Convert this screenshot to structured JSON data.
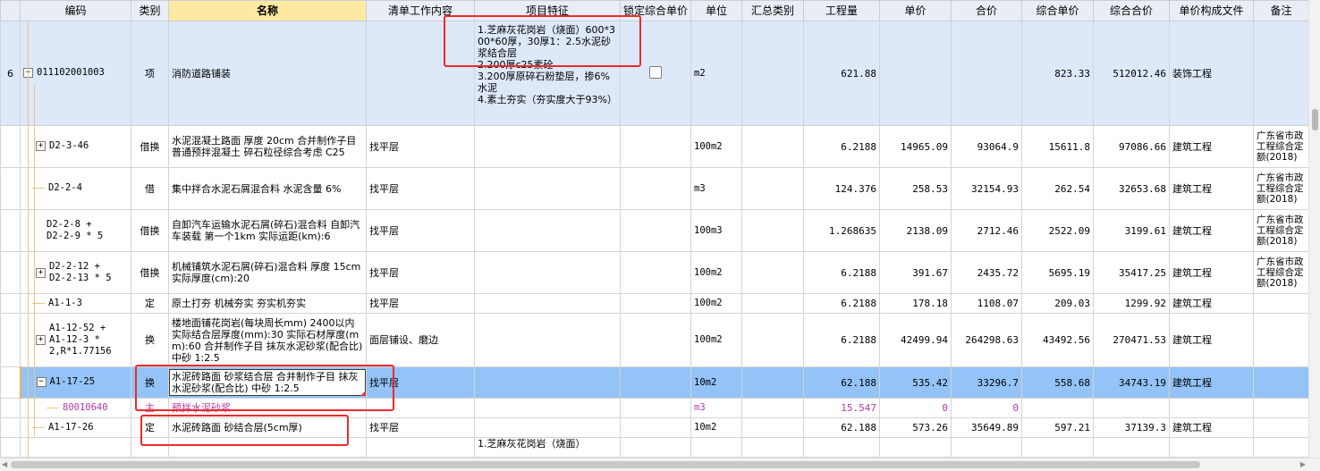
{
  "columns": [
    "编码",
    "类别",
    "名称",
    "清单工作内容",
    "项目特征",
    "锁定综合单价",
    "单位",
    "汇总类别",
    "工程量",
    "单价",
    "合价",
    "综合单价",
    "综合合价",
    "单价构成文件",
    "备注"
  ],
  "rows": [
    {
      "num": "6",
      "code": "011102001003",
      "type": "项",
      "name": "消防道路铺装",
      "work": "",
      "feature": "1.芝麻灰花岗岩（烧面）600*300*60厚，30厚1：2.5水泥砂浆结合层\n2.200厚c25素砼\n3.200厚原碎石粉垫层，掺6%水泥\n4.素土夯实（夯实度大于93%）",
      "unit": "m2",
      "qty": "621.88",
      "price": "",
      "total": "",
      "uprice": "823.33",
      "utotal": "512012.46",
      "file": "装饰工程",
      "remark": ""
    },
    {
      "num": "",
      "code": "D2-3-46",
      "type": "借换",
      "name": "水泥混凝土路面 厚度 20cm  合并制作子目 普通预拌混凝土 碎石粒径综合考虑 C25",
      "work": "找平层",
      "feature": "",
      "unit": "100m2",
      "qty": "6.2188",
      "price": "14965.09",
      "total": "93064.9",
      "uprice": "15611.8",
      "utotal": "97086.66",
      "file": "建筑工程",
      "remark": "广东省市政工程综合定额(2018)"
    },
    {
      "num": "",
      "code": "D2-2-4",
      "type": "借",
      "name": "集中拌合水泥石屑混合料 水泥含量 6%",
      "work": "找平层",
      "feature": "",
      "unit": "m3",
      "qty": "124.376",
      "price": "258.53",
      "total": "32154.93",
      "uprice": "262.54",
      "utotal": "32653.68",
      "file": "建筑工程",
      "remark": "广东省市政工程综合定额(2018)"
    },
    {
      "num": "",
      "code": "D2-2-8 +\nD2-2-9 * 5",
      "type": "借换",
      "name": "自卸汽车运输水泥石屑(碎石)混合料 自卸汽车装载 第一个1km  实际运距(km):6",
      "work": "找平层",
      "feature": "",
      "unit": "100m3",
      "qty": "1.268635",
      "price": "2138.09",
      "total": "2712.46",
      "uprice": "2522.09",
      "utotal": "3199.61",
      "file": "建筑工程",
      "remark": "广东省市政工程综合定额(2018)"
    },
    {
      "num": "",
      "code": "D2-2-12 +\nD2-2-13 * 5",
      "type": "借换",
      "name": "机械铺筑水泥石屑(碎石)混合料 厚度 15cm  实际厚度(cm):20",
      "work": "找平层",
      "feature": "",
      "unit": "100m2",
      "qty": "6.2188",
      "price": "391.67",
      "total": "2435.72",
      "uprice": "5695.19",
      "utotal": "35417.25",
      "file": "建筑工程",
      "remark": "广东省市政工程综合定额(2018)"
    },
    {
      "num": "",
      "code": "A1-1-3",
      "type": "定",
      "name": "原土打夯 机械夯实 夯实机夯实",
      "work": "找平层",
      "feature": "",
      "unit": "100m2",
      "qty": "6.2188",
      "price": "178.18",
      "total": "1108.07",
      "uprice": "209.03",
      "utotal": "1299.92",
      "file": "建筑工程",
      "remark": ""
    },
    {
      "num": "",
      "code": "A1-12-52 +\nA1-12-3 *\n2,R*1.77156",
      "type": "换",
      "name": "楼地面铺花岗岩(每块周长mm) 2400以内  实际结合层厚度(mm):30  实际石材厚度(mm):60  合并制作子目 抹灰水泥砂浆(配合比) 中砂 1:2.5",
      "work": "面层铺设、磨边",
      "feature": "",
      "unit": "100m2",
      "qty": "6.2188",
      "price": "42499.94",
      "total": "264298.63",
      "uprice": "43492.56",
      "utotal": "270471.53",
      "file": "建筑工程",
      "remark": ""
    },
    {
      "num": "",
      "code": "A1-17-25",
      "type": "换",
      "name": "水泥砖路面 砂浆结合层  合并制作子目 抹灰水泥砂浆(配合比) 中砂 1:2.5",
      "work": "找平层",
      "feature": "",
      "unit": "10m2",
      "qty": "62.188",
      "price": "535.42",
      "total": "33296.7",
      "uprice": "558.68",
      "utotal": "34743.19",
      "file": "建筑工程",
      "remark": ""
    },
    {
      "num": "",
      "code": "80010640",
      "type": "主",
      "name": "预拌水泥砂浆",
      "work": "",
      "feature": "",
      "unit": "m3",
      "qty": "15.547",
      "price": "0",
      "total": "0",
      "uprice": "",
      "utotal": "",
      "file": "",
      "remark": ""
    },
    {
      "num": "",
      "code": "A1-17-26",
      "type": "定",
      "name": "水泥砖路面 砂结合层(5cm厚)",
      "work": "找平层",
      "feature": "",
      "unit": "10m2",
      "qty": "62.188",
      "price": "573.26",
      "total": "35649.89",
      "uprice": "597.21",
      "utotal": "37139.3",
      "file": "建筑工程",
      "remark": ""
    },
    {
      "num": "",
      "code": "",
      "type": "",
      "name": "",
      "work": "",
      "feature": "1.芝麻灰花岗岩（烧面）",
      "unit": "",
      "qty": "",
      "price": "",
      "total": "",
      "uprice": "",
      "utotal": "",
      "file": "",
      "remark": ""
    }
  ],
  "icons": {
    "expand": "plus-icon",
    "collapse": "minus-icon"
  },
  "colors": {
    "header_bg": "#e9eef6",
    "qd_row": "#dde8f9",
    "selected_row": "#93c3f7",
    "material_text": "#b23aa9",
    "highlight_box": "#ee2a2a"
  }
}
